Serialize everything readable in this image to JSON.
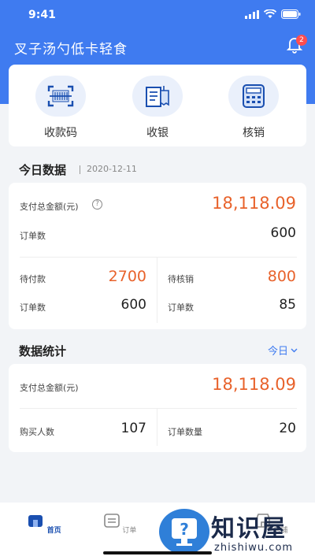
{
  "status": {
    "time": "9:41"
  },
  "header": {
    "title": "叉子汤勺低卡轻食",
    "badge": "2"
  },
  "quick": [
    {
      "label": "收款码",
      "icon": "qr-scan-icon"
    },
    {
      "label": "收银",
      "icon": "receipt-icon"
    },
    {
      "label": "核销",
      "icon": "calculator-icon"
    }
  ],
  "today": {
    "title": "今日数据",
    "date": "2020-12-11",
    "total_label": "支付总金额(元)",
    "total_value": "18,118.09",
    "orders_label": "订单数",
    "orders_value": "600",
    "pending_pay_label": "待付款",
    "pending_pay_value": "2700",
    "pending_pay_orders_label": "订单数",
    "pending_pay_orders_value": "600",
    "pending_verify_label": "待核销",
    "pending_verify_value": "800",
    "pending_verify_orders_label": "订单数",
    "pending_verify_orders_value": "85"
  },
  "stats": {
    "title": "数据统计",
    "range": "今日",
    "total_label": "支付总金额(元)",
    "total_value": "18,118.09",
    "buyers_label": "购买人数",
    "buyers_value": "107",
    "order_count_label": "订单数量",
    "order_count_value": "20"
  },
  "tabs": [
    {
      "label": "首页",
      "icon": "home-icon"
    },
    {
      "label": "订单",
      "icon": "order-icon"
    },
    {
      "label": "店铺",
      "icon": "store-icon"
    }
  ],
  "watermark": {
    "text": "知识屋",
    "sub": "zhishiwu.com"
  },
  "colors": {
    "primary": "#3f7bf0",
    "accent": "#e8622b"
  }
}
